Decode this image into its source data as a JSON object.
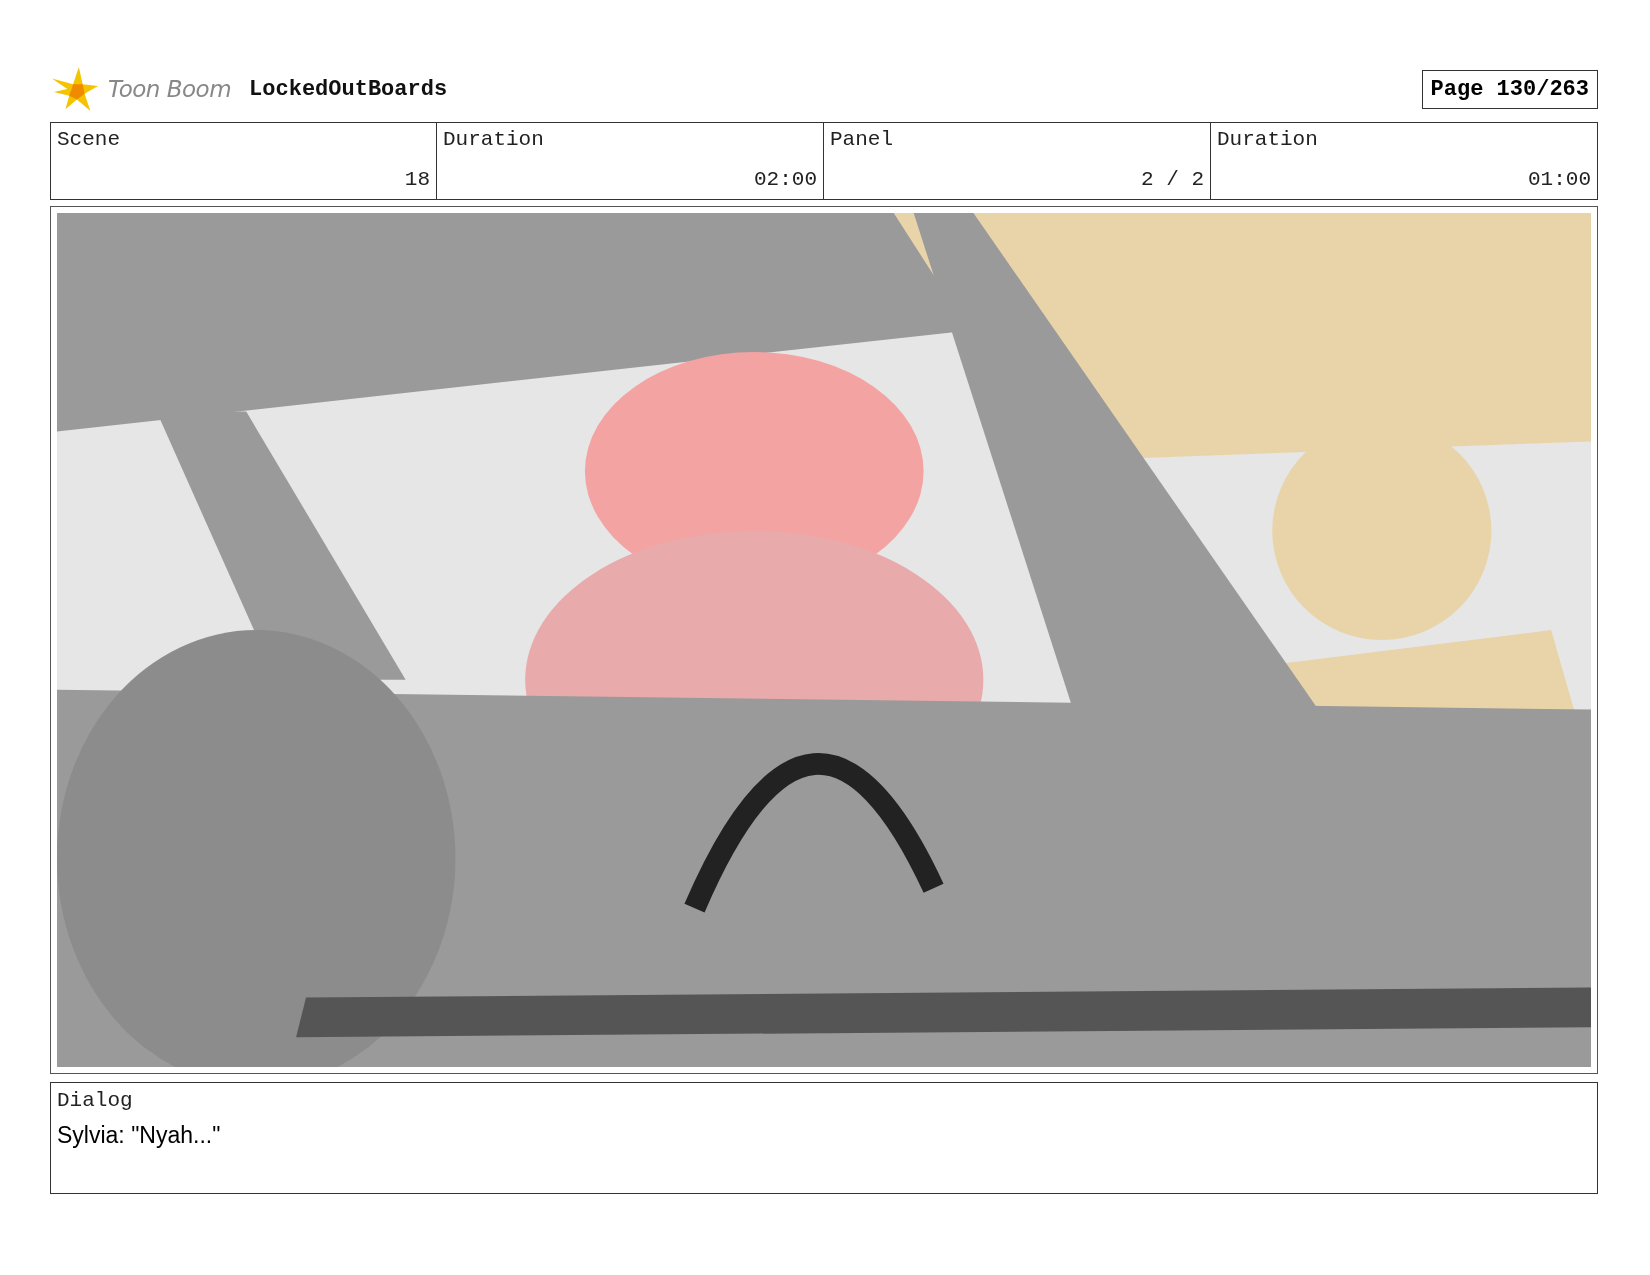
{
  "header": {
    "logo": "Toon Boom",
    "project": "LockedOutBoards",
    "page": "Page 130/263"
  },
  "info_table": {
    "columns": [
      "Scene",
      "Duration",
      "Panel",
      "Duration"
    ],
    "rows": [
      [
        "18",
        "02:00",
        "2 / 2",
        "01:00"
      ]
    ]
  },
  "dialog": {
    "label": "Dialog",
    "text": "Sylvia: \"Nyah...\""
  }
}
